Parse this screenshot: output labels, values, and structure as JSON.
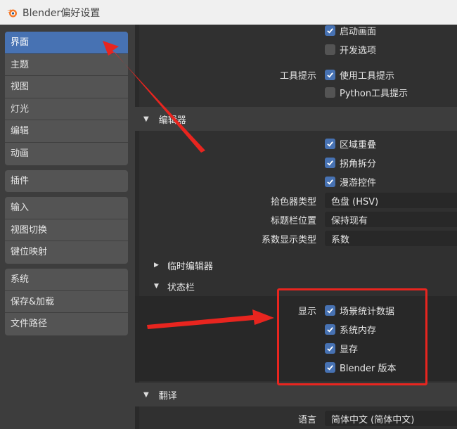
{
  "window": {
    "title": "Blender偏好设置"
  },
  "sidebar": {
    "groups": [
      [
        "界面",
        "主题",
        "视图",
        "灯光",
        "编辑",
        "动画"
      ],
      [
        "插件"
      ],
      [
        "输入",
        "视图切换",
        "键位映射"
      ],
      [
        "系统",
        "保存&加载",
        "文件路径"
      ]
    ],
    "active": "界面"
  },
  "main": {
    "top": {
      "startup_anim": {
        "label": "启动画面",
        "checked": true
      },
      "dev_options": {
        "label": "开发选项",
        "checked": false
      },
      "tooltips_label": "工具提示",
      "use_tooltips": {
        "label": "使用工具提示",
        "checked": true
      },
      "python_tooltips": {
        "label": "Python工具提示",
        "checked": false
      }
    },
    "editors": {
      "title": "编辑器",
      "region_overlap": {
        "label": "区域重叠",
        "checked": true
      },
      "corner_split": {
        "label": "拐角拆分",
        "checked": true
      },
      "navigation_controls": {
        "label": "漫游控件",
        "checked": true
      },
      "color_picker_label": "拾色器类型",
      "color_picker_value": "色盘 (HSV)",
      "header_position_label": "标题栏位置",
      "header_position_value": "保持现有",
      "factor_display_label": "系数显示类型",
      "factor_display_value": "系数",
      "temp_editors": "临时编辑器",
      "status_bar": "状态栏",
      "show_label": "显示",
      "scene_stats": {
        "label": "场景统计数据",
        "checked": true
      },
      "system_memory": {
        "label": "系统内存",
        "checked": true
      },
      "video_memory": {
        "label": "显存",
        "checked": true
      },
      "blender_version": {
        "label": "Blender 版本",
        "checked": true
      }
    },
    "translation": {
      "title": "翻译",
      "language_label": "语言",
      "language_value": "简体中文 (简体中文)"
    }
  },
  "colors": {
    "accent": "#4772b3",
    "annotation": "#e8251f",
    "background": "#303030"
  }
}
